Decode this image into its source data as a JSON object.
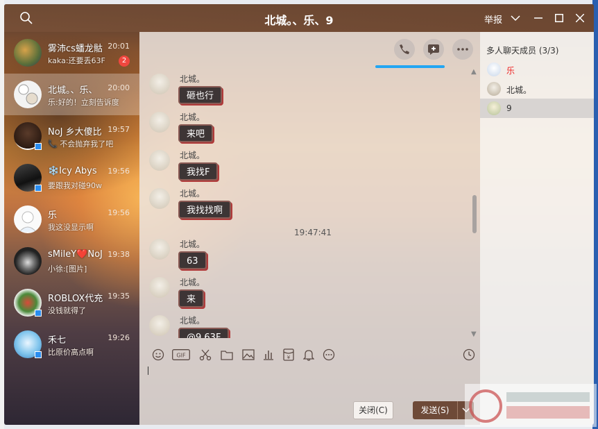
{
  "window": {
    "title": "北城。、乐、9",
    "report_label": "举报"
  },
  "colors": {
    "title_bar": "#6e4a38",
    "badge": "#f0473f",
    "scroll_line": "#23a6f2",
    "bubble": "#3d3535",
    "member_owner": "#e22222"
  },
  "conversations": [
    {
      "name": "雾沛cs蟠龙骷",
      "preview": "kaka:还要丢63F",
      "time": "20:01",
      "badge": "2",
      "active": false
    },
    {
      "name": "北城。、乐、",
      "preview": "乐:好的！立刻告诉度",
      "time": "20:00",
      "badge": "",
      "active": true
    },
    {
      "name": "NoJ 乡大傻比",
      "preview": "📞 不会抛弃我了吧",
      "time": "19:57",
      "badge": "",
      "active": false
    },
    {
      "name": "❄️Icy Abys",
      "preview": "要跟我对碰90w",
      "time": "19:56",
      "badge": "",
      "active": false
    },
    {
      "name": "乐",
      "preview": "我这没显示啊",
      "time": "19:56",
      "badge": "",
      "active": false
    },
    {
      "name": "sMileY❤️NoJ",
      "preview": "小徐:[图片]",
      "time": "19:38",
      "badge": "",
      "active": false
    },
    {
      "name": "ROBLOX代充",
      "preview": "没钱就得了",
      "time": "19:35",
      "badge": "",
      "active": false
    },
    {
      "name": "禾七",
      "preview": "比原价高点啊",
      "time": "19:26",
      "badge": "",
      "active": false
    }
  ],
  "messages": [
    {
      "sender": "北城。",
      "text": "砸也行"
    },
    {
      "sender": "北城。",
      "text": "来吧"
    },
    {
      "sender": "北城。",
      "text": "我找F"
    },
    {
      "sender": "北城。",
      "text": "我找找啊"
    },
    {
      "sender": "北城。",
      "text": "63"
    },
    {
      "sender": "北城。",
      "text": "来"
    },
    {
      "sender": "北城。",
      "text": "@9 63F"
    }
  ],
  "timestamp_divider": "19:47:41",
  "buttons": {
    "close": "关闭(C)",
    "send": "发送(S)"
  },
  "members_panel": {
    "title": "多人聊天成员 (3/3)",
    "members": [
      {
        "name": "乐",
        "owner": true,
        "selected": false
      },
      {
        "name": "北城。",
        "owner": false,
        "selected": false
      },
      {
        "name": "9",
        "owner": false,
        "selected": true
      }
    ]
  }
}
